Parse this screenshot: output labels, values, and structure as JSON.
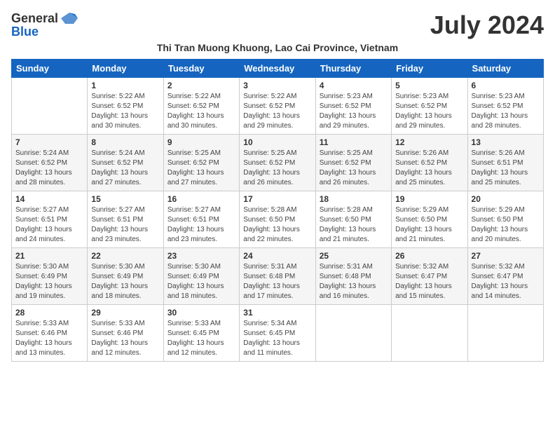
{
  "header": {
    "logo_general": "General",
    "logo_blue": "Blue",
    "month_title": "July 2024",
    "subtitle": "Thi Tran Muong Khuong, Lao Cai Province, Vietnam"
  },
  "days_of_week": [
    "Sunday",
    "Monday",
    "Tuesday",
    "Wednesday",
    "Thursday",
    "Friday",
    "Saturday"
  ],
  "weeks": [
    [
      {
        "day": "",
        "info": ""
      },
      {
        "day": "1",
        "info": "Sunrise: 5:22 AM\nSunset: 6:52 PM\nDaylight: 13 hours\nand 30 minutes."
      },
      {
        "day": "2",
        "info": "Sunrise: 5:22 AM\nSunset: 6:52 PM\nDaylight: 13 hours\nand 30 minutes."
      },
      {
        "day": "3",
        "info": "Sunrise: 5:22 AM\nSunset: 6:52 PM\nDaylight: 13 hours\nand 29 minutes."
      },
      {
        "day": "4",
        "info": "Sunrise: 5:23 AM\nSunset: 6:52 PM\nDaylight: 13 hours\nand 29 minutes."
      },
      {
        "day": "5",
        "info": "Sunrise: 5:23 AM\nSunset: 6:52 PM\nDaylight: 13 hours\nand 29 minutes."
      },
      {
        "day": "6",
        "info": "Sunrise: 5:23 AM\nSunset: 6:52 PM\nDaylight: 13 hours\nand 28 minutes."
      }
    ],
    [
      {
        "day": "7",
        "info": "Sunrise: 5:24 AM\nSunset: 6:52 PM\nDaylight: 13 hours\nand 28 minutes."
      },
      {
        "day": "8",
        "info": "Sunrise: 5:24 AM\nSunset: 6:52 PM\nDaylight: 13 hours\nand 27 minutes."
      },
      {
        "day": "9",
        "info": "Sunrise: 5:25 AM\nSunset: 6:52 PM\nDaylight: 13 hours\nand 27 minutes."
      },
      {
        "day": "10",
        "info": "Sunrise: 5:25 AM\nSunset: 6:52 PM\nDaylight: 13 hours\nand 26 minutes."
      },
      {
        "day": "11",
        "info": "Sunrise: 5:25 AM\nSunset: 6:52 PM\nDaylight: 13 hours\nand 26 minutes."
      },
      {
        "day": "12",
        "info": "Sunrise: 5:26 AM\nSunset: 6:52 PM\nDaylight: 13 hours\nand 25 minutes."
      },
      {
        "day": "13",
        "info": "Sunrise: 5:26 AM\nSunset: 6:51 PM\nDaylight: 13 hours\nand 25 minutes."
      }
    ],
    [
      {
        "day": "14",
        "info": "Sunrise: 5:27 AM\nSunset: 6:51 PM\nDaylight: 13 hours\nand 24 minutes."
      },
      {
        "day": "15",
        "info": "Sunrise: 5:27 AM\nSunset: 6:51 PM\nDaylight: 13 hours\nand 23 minutes."
      },
      {
        "day": "16",
        "info": "Sunrise: 5:27 AM\nSunset: 6:51 PM\nDaylight: 13 hours\nand 23 minutes."
      },
      {
        "day": "17",
        "info": "Sunrise: 5:28 AM\nSunset: 6:50 PM\nDaylight: 13 hours\nand 22 minutes."
      },
      {
        "day": "18",
        "info": "Sunrise: 5:28 AM\nSunset: 6:50 PM\nDaylight: 13 hours\nand 21 minutes."
      },
      {
        "day": "19",
        "info": "Sunrise: 5:29 AM\nSunset: 6:50 PM\nDaylight: 13 hours\nand 21 minutes."
      },
      {
        "day": "20",
        "info": "Sunrise: 5:29 AM\nSunset: 6:50 PM\nDaylight: 13 hours\nand 20 minutes."
      }
    ],
    [
      {
        "day": "21",
        "info": "Sunrise: 5:30 AM\nSunset: 6:49 PM\nDaylight: 13 hours\nand 19 minutes."
      },
      {
        "day": "22",
        "info": "Sunrise: 5:30 AM\nSunset: 6:49 PM\nDaylight: 13 hours\nand 18 minutes."
      },
      {
        "day": "23",
        "info": "Sunrise: 5:30 AM\nSunset: 6:49 PM\nDaylight: 13 hours\nand 18 minutes."
      },
      {
        "day": "24",
        "info": "Sunrise: 5:31 AM\nSunset: 6:48 PM\nDaylight: 13 hours\nand 17 minutes."
      },
      {
        "day": "25",
        "info": "Sunrise: 5:31 AM\nSunset: 6:48 PM\nDaylight: 13 hours\nand 16 minutes."
      },
      {
        "day": "26",
        "info": "Sunrise: 5:32 AM\nSunset: 6:47 PM\nDaylight: 13 hours\nand 15 minutes."
      },
      {
        "day": "27",
        "info": "Sunrise: 5:32 AM\nSunset: 6:47 PM\nDaylight: 13 hours\nand 14 minutes."
      }
    ],
    [
      {
        "day": "28",
        "info": "Sunrise: 5:33 AM\nSunset: 6:46 PM\nDaylight: 13 hours\nand 13 minutes."
      },
      {
        "day": "29",
        "info": "Sunrise: 5:33 AM\nSunset: 6:46 PM\nDaylight: 13 hours\nand 12 minutes."
      },
      {
        "day": "30",
        "info": "Sunrise: 5:33 AM\nSunset: 6:45 PM\nDaylight: 13 hours\nand 12 minutes."
      },
      {
        "day": "31",
        "info": "Sunrise: 5:34 AM\nSunset: 6:45 PM\nDaylight: 13 hours\nand 11 minutes."
      },
      {
        "day": "",
        "info": ""
      },
      {
        "day": "",
        "info": ""
      },
      {
        "day": "",
        "info": ""
      }
    ]
  ]
}
